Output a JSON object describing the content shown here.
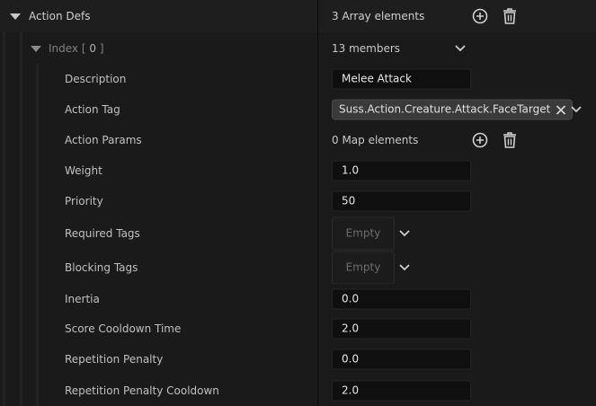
{
  "header": {
    "title": "Action Defs",
    "array_count": "3 Array elements"
  },
  "index_row": {
    "prefix": "Index",
    "bracket_open": "[",
    "index": "0",
    "bracket_close": "]",
    "members": "13 members"
  },
  "properties": {
    "description": {
      "label": "Description",
      "value": "Melee Attack"
    },
    "action_tag": {
      "label": "Action Tag",
      "value": "Suss.Action.Creature.Attack.FaceTarget"
    },
    "action_params": {
      "label": "Action Params",
      "value": "0 Map elements"
    },
    "weight": {
      "label": "Weight",
      "value": "1.0"
    },
    "priority": {
      "label": "Priority",
      "value": "50"
    },
    "required_tags": {
      "label": "Required Tags",
      "value": "Empty"
    },
    "blocking_tags": {
      "label": "Blocking Tags",
      "value": "Empty"
    },
    "inertia": {
      "label": "Inertia",
      "value": "0.0"
    },
    "score_cooldown_time": {
      "label": "Score Cooldown Time",
      "value": "2.0"
    },
    "repetition_penalty": {
      "label": "Repetition Penalty",
      "value": "0.0"
    },
    "repetition_penalty_cooldown": {
      "label": "Repetition Penalty Cooldown",
      "value": "2.0"
    }
  },
  "icons": {
    "add": "plus-circle-icon",
    "delete": "trash-icon",
    "expand": "caret-down-icon",
    "dropdown": "chevron-down-icon",
    "clear": "close-icon"
  },
  "colors": {
    "background": "#1a1a1a",
    "field": "#0f0f0f",
    "text": "#c0c0c0",
    "value_text": "#e6e6e6",
    "chip": "#3a3a3a"
  }
}
